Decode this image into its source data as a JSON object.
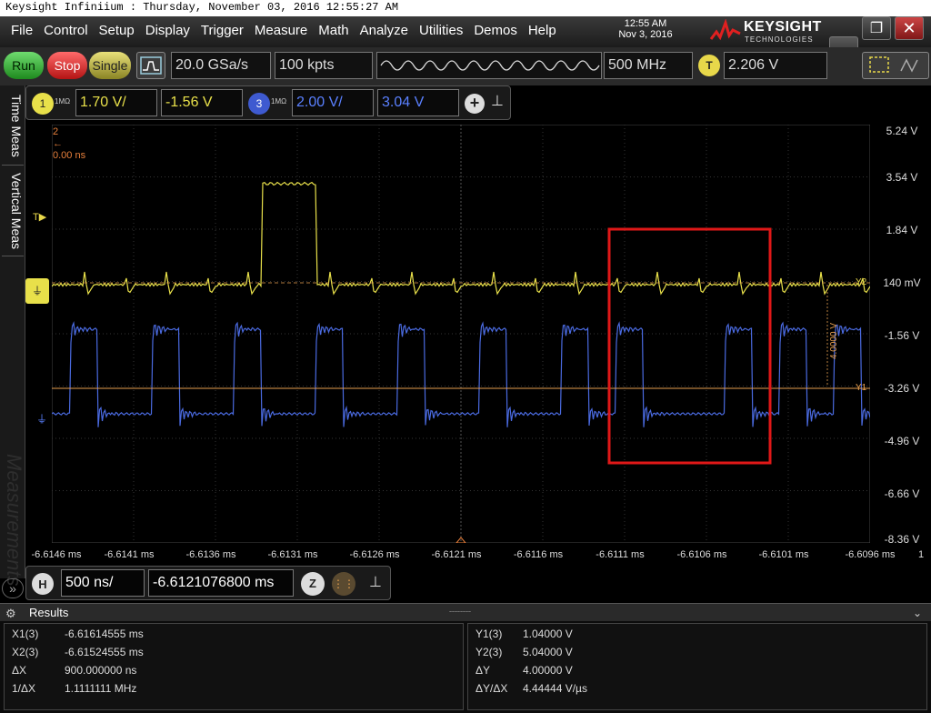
{
  "window_title": "Keysight Infiniium : Thursday, November 03, 2016 12:55:27 AM",
  "menu": [
    "File",
    "Control",
    "Setup",
    "Display",
    "Trigger",
    "Measure",
    "Math",
    "Analyze",
    "Utilities",
    "Demos",
    "Help"
  ],
  "clock": {
    "time": "12:55 AM",
    "date": "Nov 3, 2016"
  },
  "brand": {
    "name": "KEYSIGHT",
    "sub": "TECHNOLOGIES"
  },
  "window_buttons": {
    "minimize": "—",
    "restore": "❐",
    "close": "✕"
  },
  "toolbar": {
    "run": "Run",
    "stop": "Stop",
    "single": "Single",
    "sample_rate": "20.0 GSa/s",
    "memory_depth": "100 kpts",
    "bandwidth": "500 MHz",
    "trigger_badge": "T",
    "trigger_level": "2.206 V"
  },
  "channels": {
    "ch1": {
      "num": "1",
      "impedance": "1MΩ",
      "scale": "1.70 V/",
      "offset": "-1.56 V",
      "color": "#e8e04a"
    },
    "ch3": {
      "num": "3",
      "impedance": "1MΩ",
      "scale": "2.00 V/",
      "offset": "3.04 V",
      "color": "#4a6ae0"
    }
  },
  "side_tabs": [
    "Time Meas",
    "Vertical Meas"
  ],
  "side_watermark": "Measurements",
  "x_marker": {
    "label": "2",
    "value": "0.00 ns"
  },
  "y_axis_labels": [
    "5.24 V",
    "3.54 V",
    "1.84 V",
    "140 mV",
    "-1.56 V",
    "-3.26 V",
    "-4.96 V",
    "-6.66 V",
    "-8.36 V"
  ],
  "x_axis_labels": [
    "-6.6146 ms",
    "-6.6141 ms",
    "-6.6136 ms",
    "-6.6131 ms",
    "-6.6126 ms",
    "-6.6121 ms",
    "-6.6116 ms",
    "-6.6111 ms",
    "-6.6106 ms",
    "-6.6101 ms",
    "-6.6096 ms"
  ],
  "x_axis_end_marker": "1",
  "cursors": {
    "y2_tag": "Y2",
    "y1_tag": "Y1",
    "delta_label": "4.0000 V"
  },
  "horizontal": {
    "badge": "H",
    "scale": "500 ns/",
    "position": "-6.6121076800 ms",
    "zoom_label": "Z"
  },
  "results": {
    "title": "Results",
    "left": [
      {
        "label": "X1(3)",
        "value": "-6.61614555 ms"
      },
      {
        "label": "X2(3)",
        "value": "-6.61524555 ms"
      },
      {
        "label": "ΔX",
        "value": "900.000000 ns"
      },
      {
        "label": "1/ΔX",
        "value": "1.1111111 MHz"
      }
    ],
    "right": [
      {
        "label": "Y1(3)",
        "value": "1.04000 V"
      },
      {
        "label": "Y2(3)",
        "value": "5.04000 V"
      },
      {
        "label": "ΔY",
        "value": "4.00000 V"
      },
      {
        "label": "ΔY/ΔX",
        "value": "4.44444 V/µs"
      }
    ]
  },
  "colors": {
    "ch1": "#e8e04a",
    "ch3": "#4a6ae0",
    "cursor": "#e8a050",
    "highlight": "#e01818"
  }
}
